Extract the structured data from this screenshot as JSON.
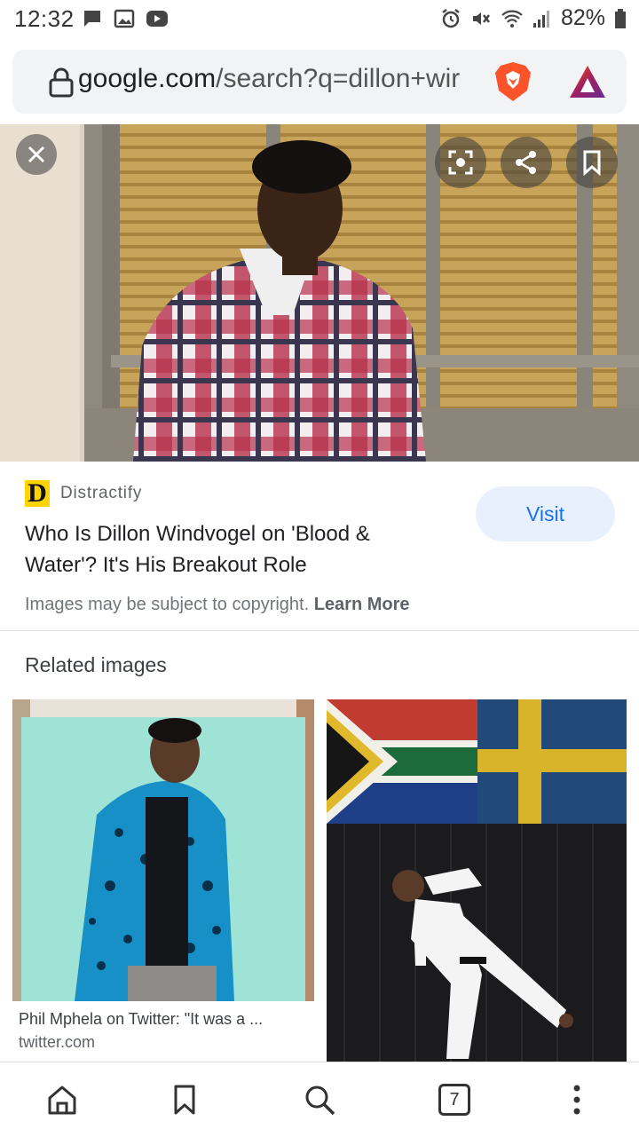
{
  "status_bar": {
    "time": "12:32",
    "battery": "82%"
  },
  "browser": {
    "url_domain": "google.com",
    "url_path": "/search?q=dillon+wir"
  },
  "result": {
    "source_logo_letter": "D",
    "source_name": "Distractify",
    "title": "Who Is Dillon Windvogel on 'Blood & Water'? It's His Breakout Role",
    "visit_label": "Visit",
    "copyright_text": "Images may be subject to copyright.",
    "learn_more_label": "Learn More"
  },
  "related": {
    "heading": "Related images",
    "items": [
      {
        "caption": "Phil Mphela on Twitter: \"It was a ...",
        "domain": "twitter.com"
      },
      {
        "caption": "",
        "domain": ""
      }
    ]
  },
  "bottom_nav": {
    "tab_count": "7"
  },
  "colors": {
    "accent": "#1a73e8",
    "visit_bg": "#e8f0fe",
    "brave_orange": "#fb542b",
    "source_logo_bg": "#ffd400"
  }
}
